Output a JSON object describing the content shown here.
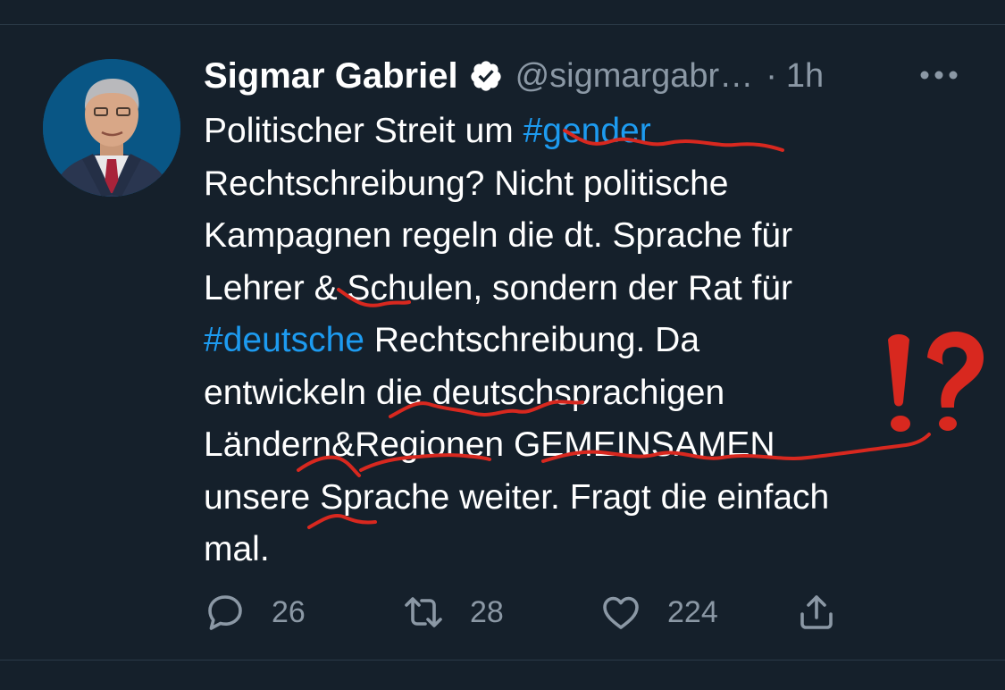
{
  "tweet": {
    "author": {
      "name": "Sigmar Gabriel",
      "handle": "@sigmargabr…",
      "verified": true,
      "avatar": "portrait-photo"
    },
    "separator": "·",
    "time": "1h",
    "more_icon": "more-horizontal-icon",
    "text": {
      "l1_a": "Politischer Streit um ",
      "l1_tag": "#gender",
      "l2": "Rechtschreibung? Nicht politische",
      "l3": "Kampagnen regeln die dt. Sprache für",
      "l4": "Lehrer &  Schulen, sondern der Rat für",
      "l5_tag": "#deutsche",
      "l5_b": " Rechtschreibung. Da",
      "l6": "entwickeln die  deutschsprachigen",
      "l7": "Ländern&Regionen  GEMEINSAMEN",
      "l8": "unsere  Sprache weiter. Fragt die einfach",
      "l9": "mal."
    },
    "actions": {
      "reply": {
        "icon": "reply-icon",
        "count": "26"
      },
      "retweet": {
        "icon": "retweet-icon",
        "count": "28"
      },
      "like": {
        "icon": "heart-icon",
        "count": "224"
      },
      "share": {
        "icon": "share-icon"
      }
    }
  },
  "annotation": {
    "color": "#d8281f",
    "mark": "!?"
  },
  "colors": {
    "background": "#15202b",
    "text": "#ffffff",
    "secondary": "#8b98a5",
    "link": "#1d9bf0"
  }
}
